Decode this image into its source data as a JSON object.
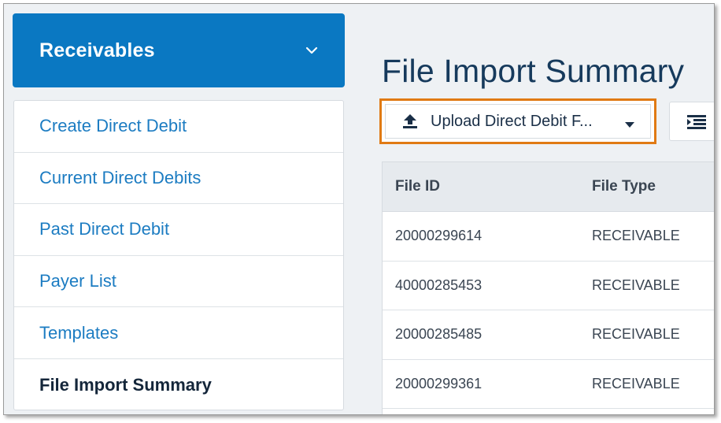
{
  "sidebar": {
    "header_title": "Receivables",
    "items": [
      {
        "label": "Create Direct Debit"
      },
      {
        "label": "Current Direct Debits"
      },
      {
        "label": "Past Direct Debit"
      },
      {
        "label": "Payer List"
      },
      {
        "label": "Templates"
      },
      {
        "label": "File Import Summary",
        "active": true
      }
    ]
  },
  "main": {
    "title": "File Import Summary",
    "upload_button": {
      "label": "Upload Direct Debit F...",
      "icon": "upload-icon"
    },
    "view_button": {
      "icon": "list-indent-icon"
    },
    "table": {
      "columns": [
        "File ID",
        "File Type"
      ],
      "rows": [
        {
          "file_id": "20000299614",
          "file_type": "RECEIVABLE"
        },
        {
          "file_id": "40000285453",
          "file_type": "RECEIVABLE"
        },
        {
          "file_id": "20000285485",
          "file_type": "RECEIVABLE"
        },
        {
          "file_id": "20000299361",
          "file_type": "RECEIVABLE"
        }
      ]
    }
  },
  "colors": {
    "brand_blue": "#0a78c2",
    "link_blue": "#1c7cc2",
    "highlight_orange": "#e07a14",
    "title_navy": "#163a5c"
  }
}
